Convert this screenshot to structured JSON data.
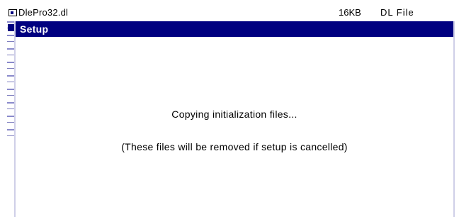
{
  "background_file": {
    "icon": "file-icon",
    "name": "DlePro32.dl",
    "size": "16KB",
    "type": "DL  File"
  },
  "setup_dialog": {
    "title": "Setup",
    "message_line_1": "Copying initialization files...",
    "message_line_2": "(These files will be removed if setup is cancelled)"
  },
  "colors": {
    "title_bar": "#000080",
    "title_text": "#ffffff",
    "background": "#ffffff"
  }
}
